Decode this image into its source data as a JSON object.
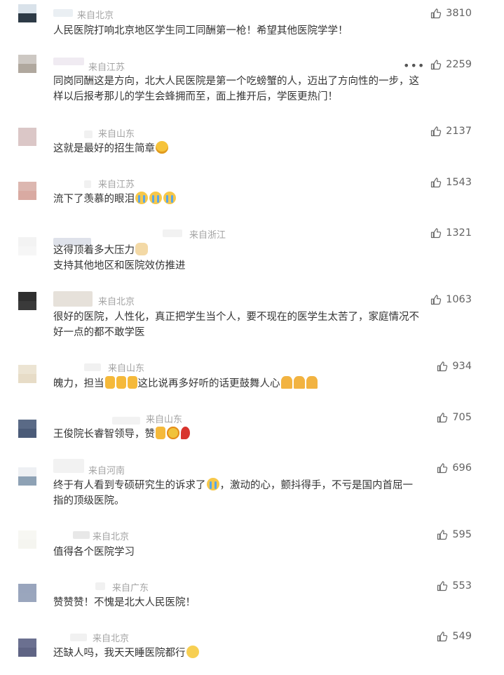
{
  "comments": [
    {
      "source": "来自北京",
      "likes": "3810",
      "lines": [
        "人民医院打响北京地区学生同工同酬第一枪！希望其他医院学学！"
      ]
    },
    {
      "source": "来自江苏",
      "likes": "2259",
      "lines": [
        "同岗同酬这是方向，北大人民医院是第一个吃螃蟹的人，迈出了方向性的一步，这",
        "样以后报考那儿的学生会蜂拥而至，面上推开后，学医更热门！"
      ],
      "more": "•••"
    },
    {
      "source": "来自山东",
      "likes": "2137",
      "lines": [
        "这就是最好的招生简章"
      ],
      "emoji_name": "laugh-cry-emoji"
    },
    {
      "source": "来自江苏",
      "likes": "1543",
      "lines": [
        "流下了羡慕的眼泪"
      ],
      "emoji_name": "crying-emoji"
    },
    {
      "source": "来自浙江",
      "likes": "1321",
      "lines": [
        "这得顶着多大压力",
        "支持其他地区和医院效仿推进"
      ],
      "emoji_name": "dog-emoji"
    },
    {
      "source": "来自北京",
      "likes": "1063",
      "lines": [
        "很好的医院，人性化，真正把学生当个人，要不现在的医学生太苦了，家庭情况不",
        "好一点的都不敢学医"
      ]
    },
    {
      "source": "来自山东",
      "likes": "934",
      "lines": [
        "魄力，担当",
        "这比说再多好听的话更鼓舞人心"
      ],
      "emoji_name": "thumbs-up-emoji"
    },
    {
      "source": "来自山东",
      "likes": "705",
      "lines": [
        "王俊院长睿智领导，赞"
      ],
      "emoji_name": "thumbs-flower-rose-emoji"
    },
    {
      "source": "来自河南",
      "likes": "696",
      "lines": [
        "终于有人看到专硕研究生的诉求了",
        "，激动的心，颤抖得手，不亏是国内首屈一",
        "指的顶级医院。"
      ],
      "emoji_name": "crying-emoji"
    },
    {
      "source": "来自北京",
      "likes": "595",
      "lines": [
        "值得各个医院学习"
      ]
    },
    {
      "source": "来自广东",
      "likes": "553",
      "lines": [
        "赞赞赞！不愧是北大人民医院！"
      ]
    },
    {
      "source": "来自北京",
      "likes": "549",
      "lines": [
        "还缺人吗，我天天睡医院都行"
      ],
      "emoji_name": "pleading-emoji"
    }
  ]
}
